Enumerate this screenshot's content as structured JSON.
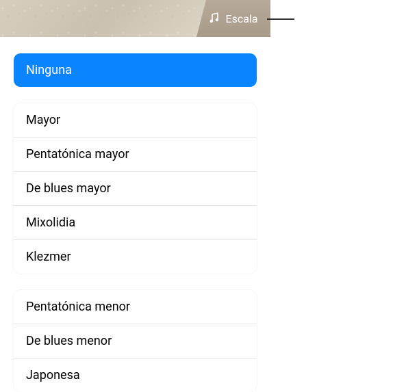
{
  "header": {
    "scale_button_label": "Escala"
  },
  "scale_menu": {
    "selected": "Ninguna",
    "groups": [
      [
        "Mayor",
        "Pentatónica mayor",
        "De blues mayor",
        "Mixolidia",
        "Klezmer"
      ],
      [
        "Pentatónica menor",
        "De blues menor",
        "Japonesa"
      ]
    ]
  }
}
